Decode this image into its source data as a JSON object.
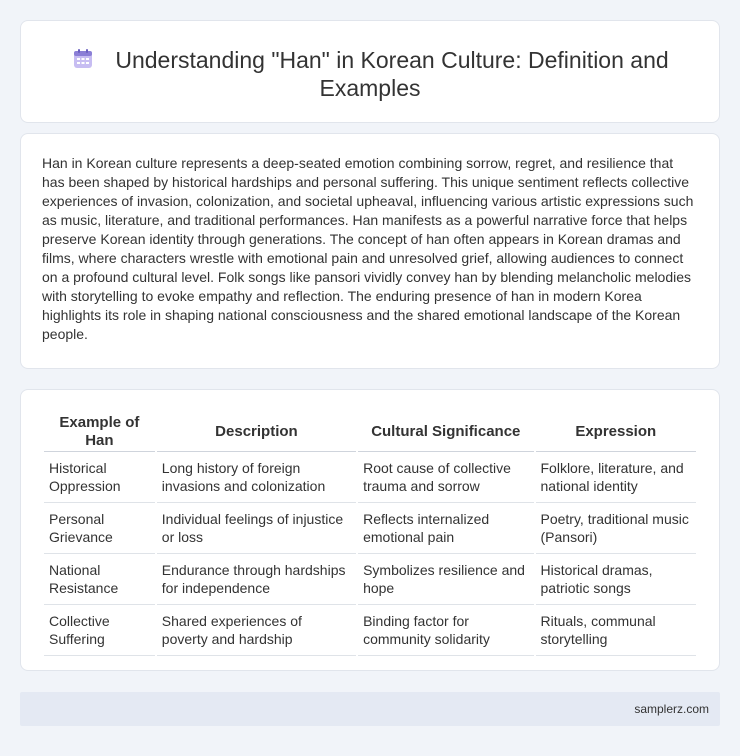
{
  "header": {
    "icon": "calendar-icon",
    "title": "Understanding \"Han\" in Korean Culture: Definition and Examples"
  },
  "intro": {
    "text": "Han in Korean culture represents a deep-seated emotion combining sorrow, regret, and resilience that has been shaped by historical hardships and personal suffering. This unique sentiment reflects collective experiences of invasion, colonization, and societal upheaval, influencing various artistic expressions such as music, literature, and traditional performances. Han manifests as a powerful narrative force that helps preserve Korean identity through generations. The concept of han often appears in Korean dramas and films, where characters wrestle with emotional pain and unresolved grief, allowing audiences to connect on a profound cultural level. Folk songs like pansori vividly convey han by blending melancholic melodies with storytelling to evoke empathy and reflection. The enduring presence of han in modern Korea highlights its role in shaping national consciousness and the shared emotional landscape of the Korean people."
  },
  "table": {
    "headers": [
      "Example of Han",
      "Description",
      "Cultural Significance",
      "Expression"
    ],
    "rows": [
      [
        "Historical Oppression",
        "Long history of foreign invasions and colonization",
        "Root cause of collective trauma and sorrow",
        "Folklore, literature, and national identity"
      ],
      [
        "Personal Grievance",
        "Individual feelings of injustice or loss",
        "Reflects internalized emotional pain",
        "Poetry, traditional music (Pansori)"
      ],
      [
        "National Resistance",
        "Endurance through hardships for independence",
        "Symbolizes resilience and hope",
        "Historical dramas, patriotic songs"
      ],
      [
        "Collective Suffering",
        "Shared experiences of poverty and hardship",
        "Binding factor for community solidarity",
        "Rituals, communal storytelling"
      ]
    ]
  },
  "footer": {
    "site": "samplerz.com"
  },
  "colors": {
    "background": "#f1f4f9",
    "card": "#ffffff",
    "footer": "#e4e9f3",
    "icon": "#8b7fd6"
  }
}
